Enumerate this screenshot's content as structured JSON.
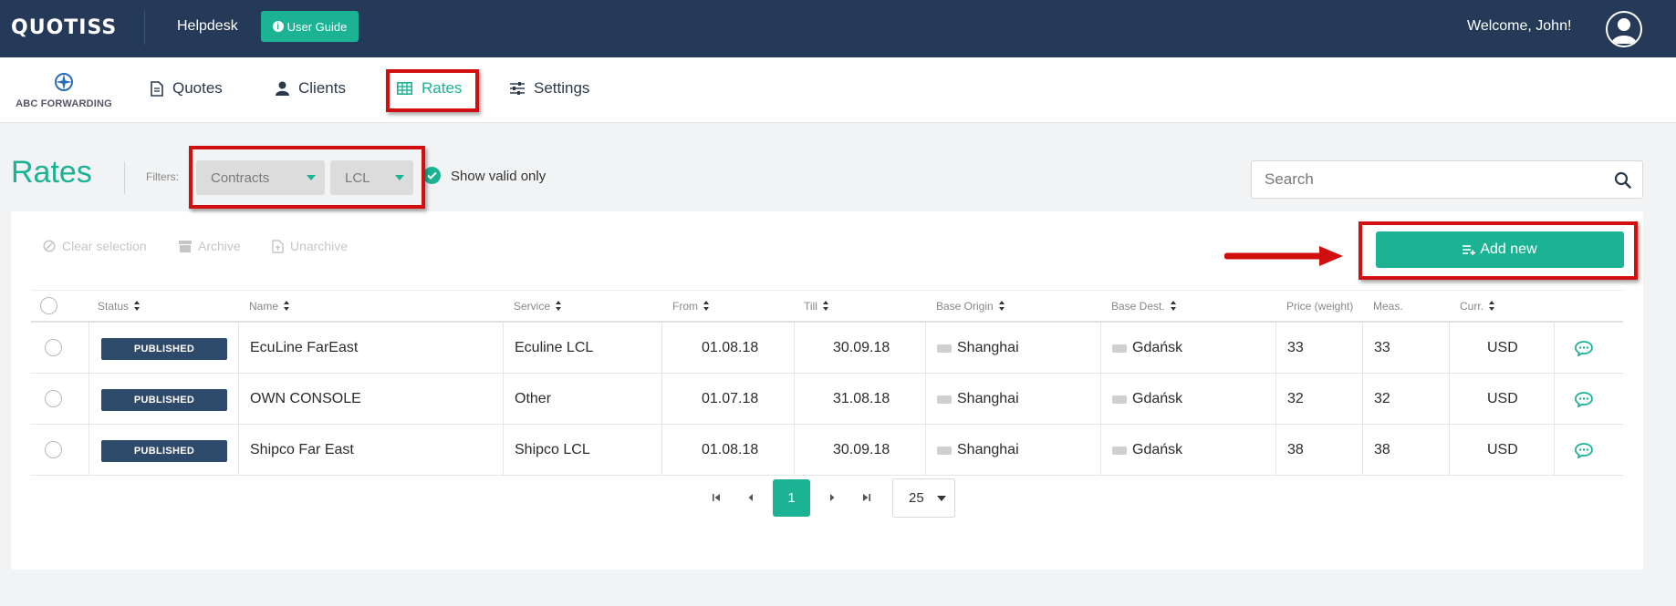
{
  "header": {
    "logo": "QUOTISS",
    "helpdesk": "Helpdesk",
    "user_guide": "User Guide",
    "welcome": "Welcome, John!"
  },
  "nav": {
    "brand": "ABC FORWARDING",
    "items": [
      {
        "label": "Quotes",
        "icon": "document-icon"
      },
      {
        "label": "Clients",
        "icon": "user-icon"
      },
      {
        "label": "Rates",
        "icon": "table-icon",
        "active": true
      },
      {
        "label": "Settings",
        "icon": "sliders-icon"
      }
    ]
  },
  "page": {
    "title": "Rates",
    "filters_label": "Filters:",
    "filter_contract": "Contracts",
    "filter_mode": "LCL",
    "show_valid": "Show valid only",
    "search_placeholder": "Search"
  },
  "actions": {
    "clear_selection": "Clear selection",
    "archive": "Archive",
    "unarchive": "Unarchive",
    "add_new": "Add new"
  },
  "table": {
    "columns": [
      "Status",
      "Name",
      "Service",
      "From",
      "Till",
      "Base Origin",
      "Base Dest.",
      "Price (weight)",
      "Meas.",
      "Curr."
    ],
    "rows": [
      {
        "status": "PUBLISHED",
        "name": "EcuLine FarEast",
        "service": "Eculine LCL",
        "from": "01.08.18",
        "till": "30.09.18",
        "origin": "Shanghai",
        "dest": "Gdańsk",
        "price": "33",
        "meas": "33",
        "curr": "USD"
      },
      {
        "status": "PUBLISHED",
        "name": "OWN CONSOLE",
        "service": "Other",
        "from": "01.07.18",
        "till": "31.08.18",
        "origin": "Shanghai",
        "dest": "Gdańsk",
        "price": "32",
        "meas": "32",
        "curr": "USD"
      },
      {
        "status": "PUBLISHED",
        "name": "Shipco Far East",
        "service": "Shipco LCL",
        "from": "01.08.18",
        "till": "30.09.18",
        "origin": "Shanghai",
        "dest": "Gdańsk",
        "price": "38",
        "meas": "38",
        "curr": "USD"
      }
    ]
  },
  "pagination": {
    "current_page": "1",
    "page_size": "25"
  },
  "colors": {
    "accent": "#1cb394",
    "topbar": "#253a58",
    "badge": "#2e4a6a",
    "annotation": "#d10f0f"
  }
}
